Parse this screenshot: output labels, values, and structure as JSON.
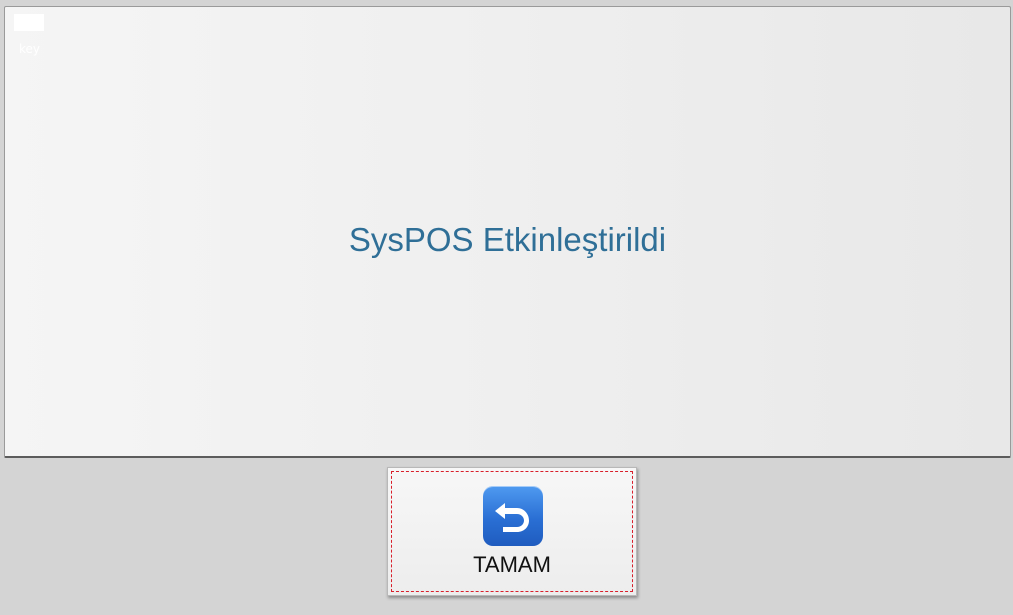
{
  "topleft": {
    "key_label": "key"
  },
  "message": {
    "text": "SysPOS Etkinleştirildi"
  },
  "ok_button": {
    "label": "TAMAM",
    "icon": "back-arrow-icon"
  },
  "colors": {
    "message_text": "#2f6f97",
    "focus_ring": "#d81e2a",
    "icon_blue": "#2a6fd4"
  }
}
